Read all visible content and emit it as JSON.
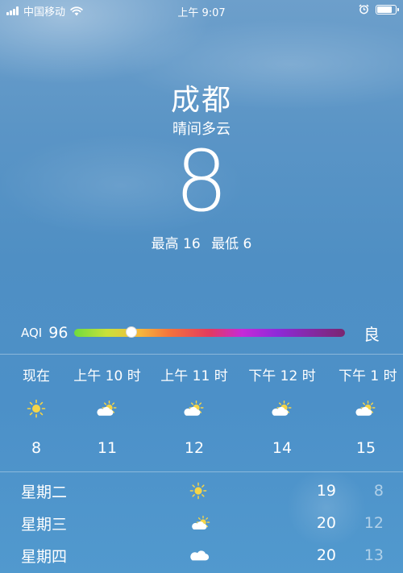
{
  "status": {
    "carrier": "中国移动",
    "time": "上午 9:07",
    "battery_level": 0.85
  },
  "weather": {
    "city": "成都",
    "condition": "晴间多云",
    "temperature": "8",
    "high": "最高 16",
    "low": "最低 6"
  },
  "aqi": {
    "label": "AQI",
    "value": "96",
    "level": "良",
    "position": 0.21
  },
  "hourly": [
    {
      "time": "现在",
      "icon": "sun-icon",
      "temp": "8"
    },
    {
      "time": "上午 10 时",
      "icon": "partly-cloudy-icon",
      "temp": "11"
    },
    {
      "time": "上午 11 时",
      "icon": "partly-cloudy-icon",
      "temp": "12"
    },
    {
      "time": "下午 12 时",
      "icon": "partly-cloudy-icon",
      "temp": "14"
    },
    {
      "time": "下午 1 时",
      "icon": "partly-cloudy-icon",
      "temp": "15"
    }
  ],
  "daily": [
    {
      "day": "星期二",
      "icon": "sun-icon",
      "high": "19",
      "low": "8"
    },
    {
      "day": "星期三",
      "icon": "partly-cloudy-icon",
      "high": "20",
      "low": "12"
    },
    {
      "day": "星期四",
      "icon": "cloud-icon",
      "high": "20",
      "low": "13"
    }
  ],
  "colors": {
    "sun": "#f5d547",
    "cloud": "#ffffff"
  }
}
